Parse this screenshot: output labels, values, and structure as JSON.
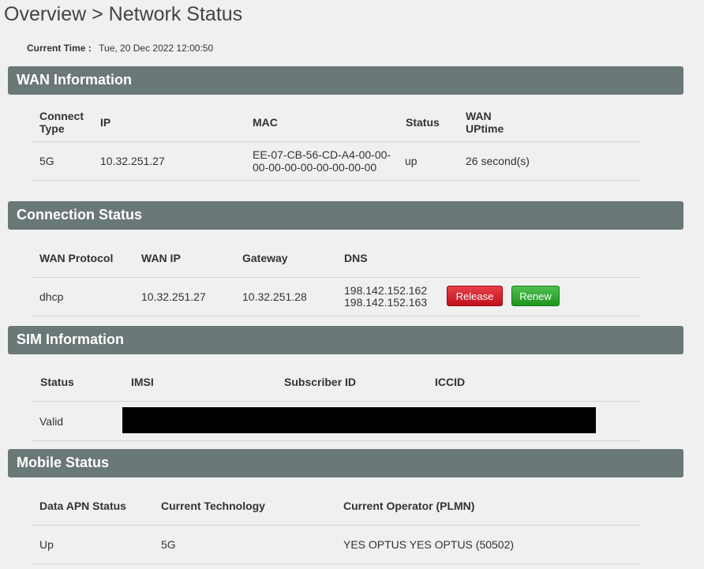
{
  "page": {
    "title": "Overview > Network Status",
    "current_time_label": "Current Time :",
    "current_time_value": "Tue, 20 Dec 2022 12:00:50"
  },
  "wan": {
    "heading": "WAN Information",
    "headers": {
      "connect_type": "Connect Type",
      "ip": "IP",
      "mac": "MAC",
      "status": "Status",
      "uptime": "WAN UPtime"
    },
    "row": {
      "connect_type": "5G",
      "ip": "10.32.251.27",
      "mac": "EE-07-CB-56-CD-A4-00-00-00-00-00-00-00-00-00-00",
      "status": "up",
      "uptime": "26 second(s)"
    }
  },
  "connection": {
    "heading": "Connection Status",
    "headers": {
      "protocol": "WAN Protocol",
      "wan_ip": "WAN IP",
      "gateway": "Gateway",
      "dns": "DNS"
    },
    "row": {
      "protocol": "dhcp",
      "wan_ip": "10.32.251.27",
      "gateway": "10.32.251.28",
      "dns1": "198.142.152.162",
      "dns2": "198.142.152.163"
    },
    "release_label": "Release",
    "renew_label": "Renew"
  },
  "sim": {
    "heading": "SIM Information",
    "headers": {
      "status": "Status",
      "imsi": "IMSI",
      "subscriber_id": "Subscriber ID",
      "iccid": "ICCID"
    },
    "row": {
      "status": "Valid"
    }
  },
  "mobile": {
    "heading": "Mobile Status",
    "headers": {
      "apn_status": "Data APN Status",
      "technology": "Current Technology",
      "operator": "Current Operator (PLMN)"
    },
    "row": {
      "apn_status": "Up",
      "technology": "5G",
      "operator": "YES OPTUS YES OPTUS (50502)"
    }
  },
  "colors": {
    "section_bar": "#6a7877",
    "release_button": "#d0202c",
    "renew_button": "#32a832",
    "redaction": "#000000"
  }
}
